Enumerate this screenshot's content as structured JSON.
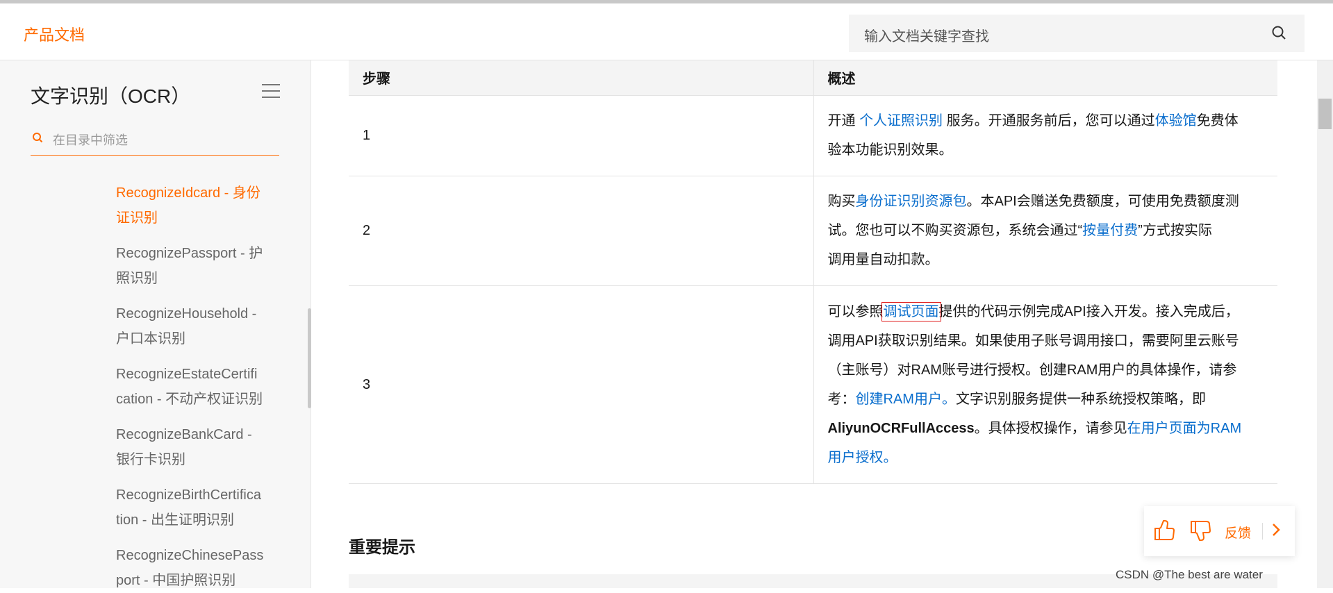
{
  "header": {
    "brand": "产品文档",
    "search_placeholder": "输入文档关键字查找"
  },
  "sidebar": {
    "title": "文字识别（OCR）",
    "filter_placeholder": "在目录中筛选",
    "items": [
      {
        "line1": "RecognizeIdcard - 身份",
        "line2": "证识别",
        "active": true
      },
      {
        "line1": "RecognizePassport - 护",
        "line2": "照识别"
      },
      {
        "line1": "RecognizeHousehold -",
        "line2": "户口本识别"
      },
      {
        "line1": "RecognizeEstateCertifi",
        "line2": "cation - 不动产权证识别"
      },
      {
        "line1": "RecognizeBankCard -",
        "line2": "银行卡识别"
      },
      {
        "line1": "RecognizeBirthCertifica",
        "line2": "tion - 出生证明识别"
      },
      {
        "line1": "RecognizeChinesePass",
        "line2": "port - 中国护照识别"
      }
    ]
  },
  "table": {
    "headers": [
      "步骤",
      "概述"
    ],
    "rows": [
      {
        "step": "1",
        "t1": "开通 ",
        "l1": "个人证照识别",
        "t2": " 服务。开通服务前后，您可以通过",
        "l2": "体验馆",
        "t3": "免费体",
        "t4": "验本功能识别效果。"
      },
      {
        "step": "2",
        "t1": "购买",
        "l1": "身份证识别资源包",
        "t2": "。本API会赠送免费额度，可使用免费额度测",
        "t3": "试。您也可以不购买资源包，系统会通过“",
        "l2": "按量付费",
        "t4": "”方式按实际",
        "t5": "调用量自动扣款。"
      },
      {
        "step": "3",
        "t1": "可以参照",
        "l1": "调试页面",
        "t2": "提供的代码示例完成API接入开发。接入完成后，",
        "t3": "调用API获取识别结果。如果使用子账号调用接口，需要阿里云账号",
        "t4": "（主账号）对RAM账号进行授权。创建RAM用户的具体操作，请参",
        "t5": "考：",
        "l2": "创建RAM用户。",
        "t6": "文字识别服务提供一种系统授权策略，即",
        "b1": "AliyunOCRFullAccess",
        "t7": "。具体授权操作，请参见",
        "l3": "在用户页面为RAM",
        "l4": "用户授权。"
      }
    ]
  },
  "notice": {
    "title": "重要提示"
  },
  "feedback": {
    "label": "反馈"
  },
  "watermark": "CSDN @The best are water",
  "colors": {
    "accent": "#ff6a00",
    "link": "#0a6ecd",
    "highlight_box": "#e02020"
  }
}
